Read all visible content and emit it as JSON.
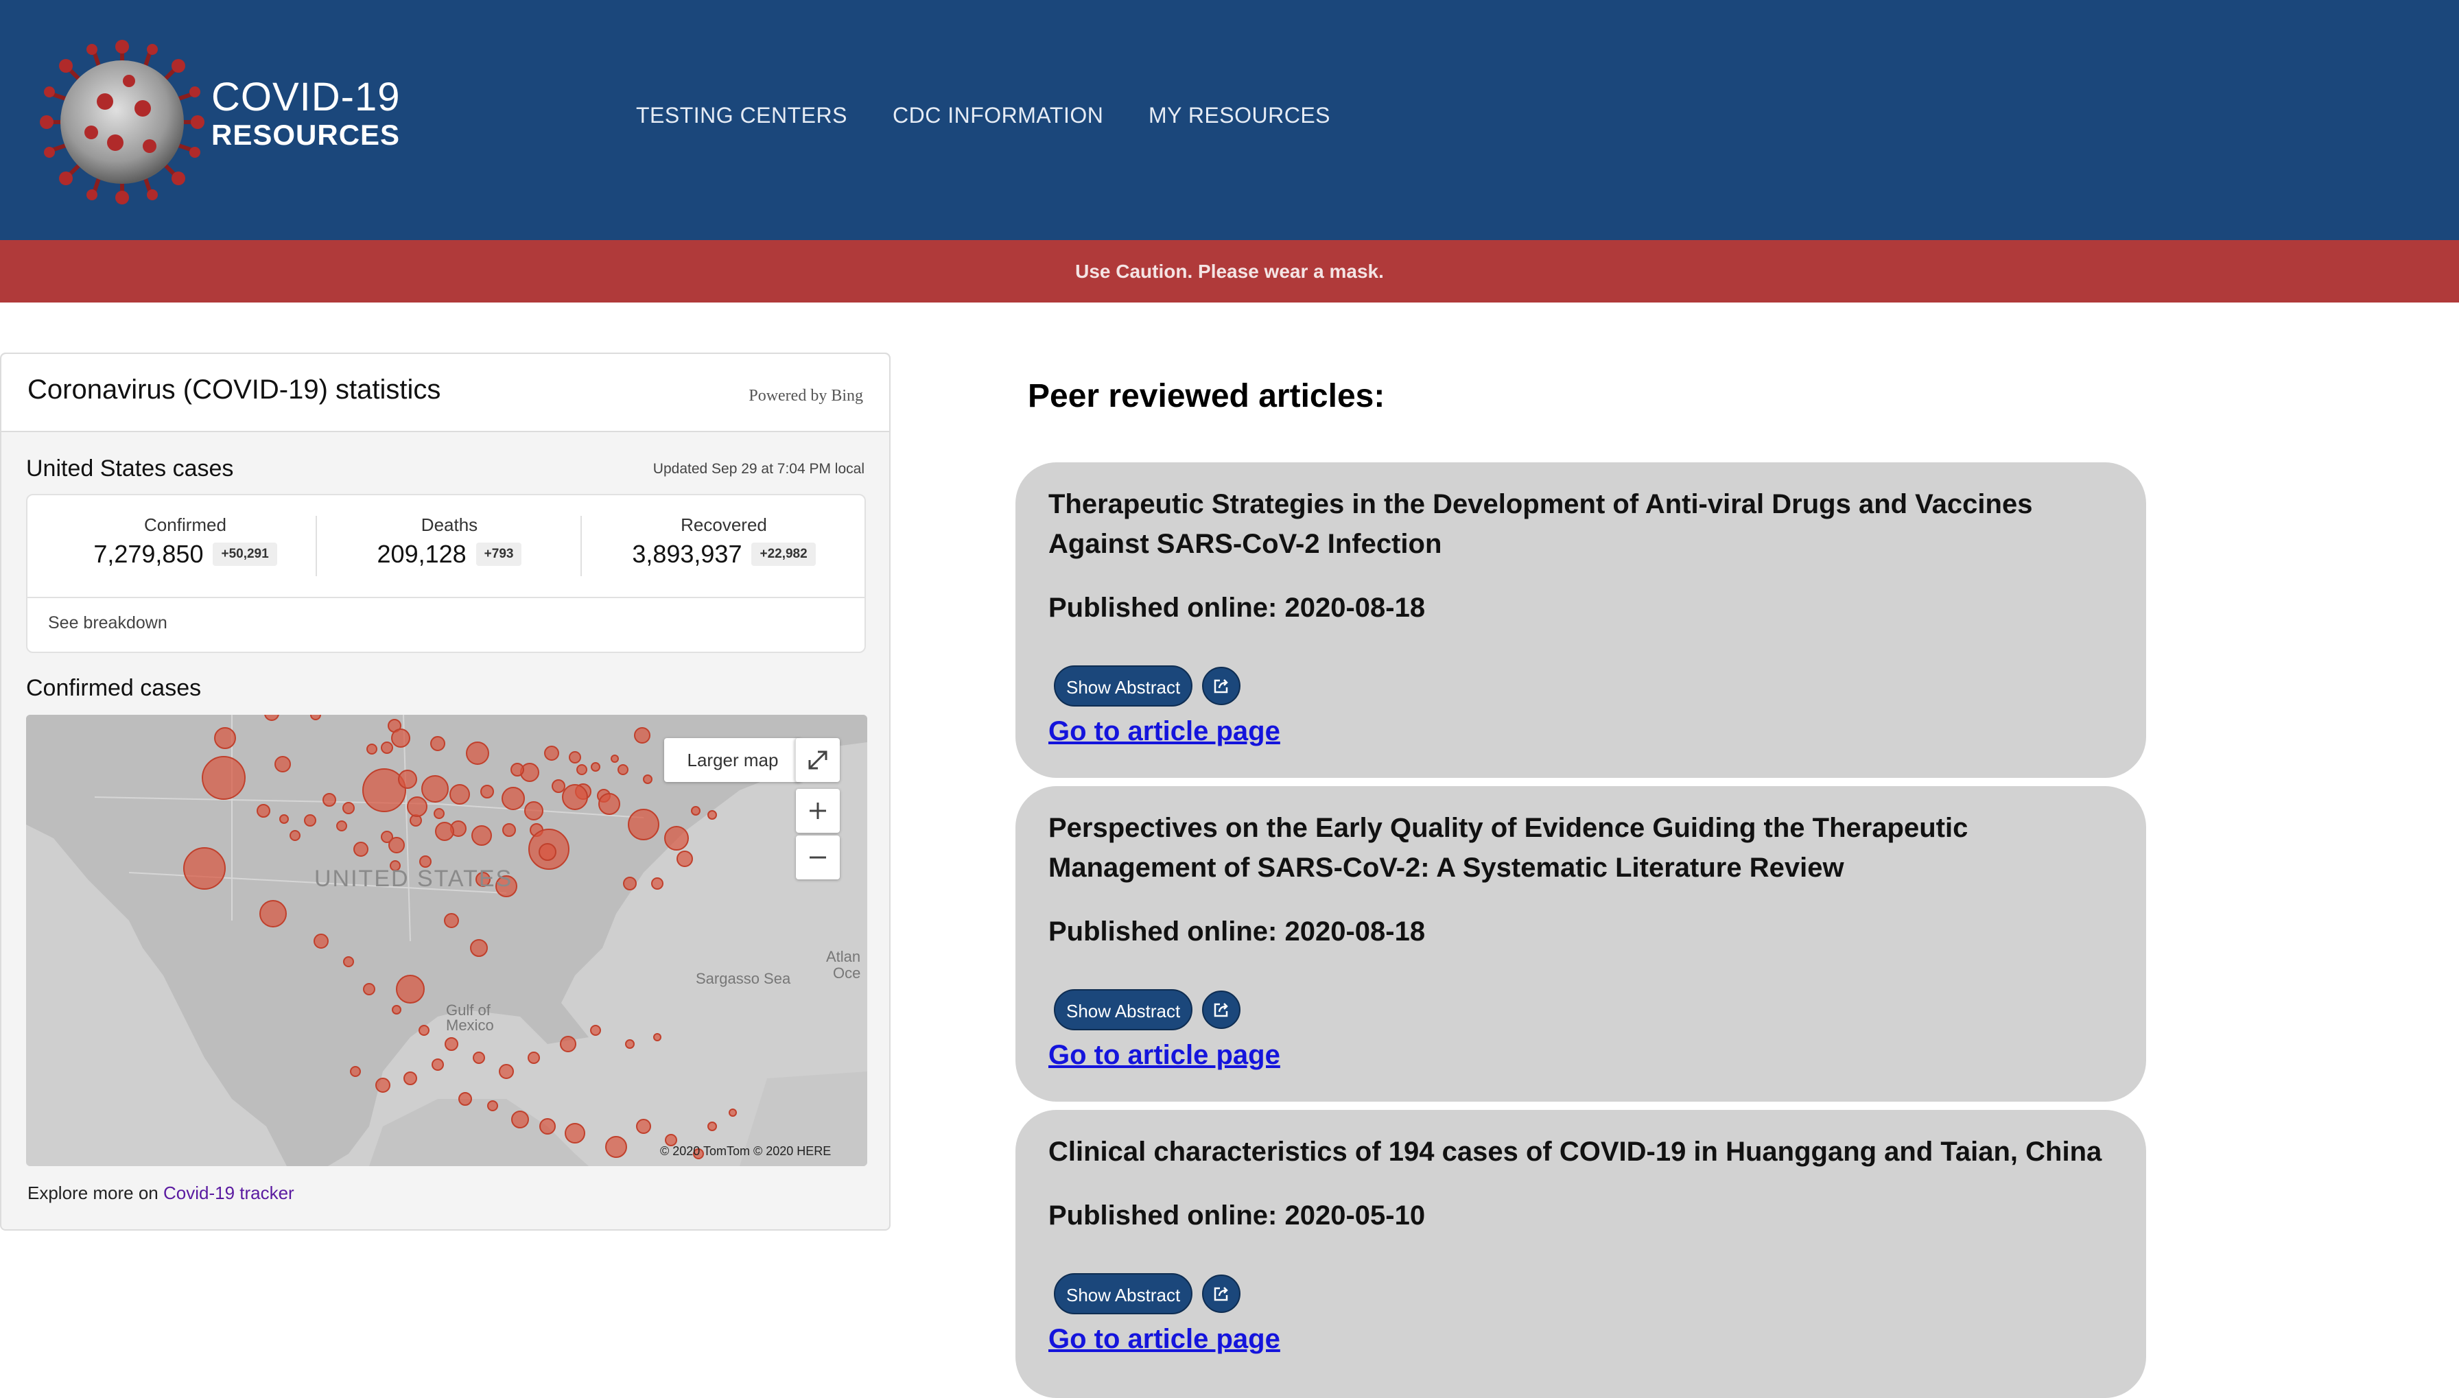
{
  "header": {
    "logo_line1": "COVID-19",
    "logo_line2": "RESOURCES",
    "nav": [
      {
        "label": "TESTING CENTERS"
      },
      {
        "label": "CDC INFORMATION"
      },
      {
        "label": "MY RESOURCES"
      }
    ]
  },
  "banner": {
    "text": "Use Caution. Please wear a mask."
  },
  "widget": {
    "title": "Coronavirus (COVID-19) statistics",
    "powered_by": "Powered by Bing",
    "region_title": "United States cases",
    "updated": "Updated Sep 29 at 7:04 PM local",
    "stats": [
      {
        "label": "Confirmed",
        "value": "7,279,850",
        "delta": "+50,291"
      },
      {
        "label": "Deaths",
        "value": "209,128",
        "delta": "+793"
      },
      {
        "label": "Recovered",
        "value": "3,893,937",
        "delta": "+22,982"
      }
    ],
    "breakdown_label": "See breakdown",
    "map_title": "Confirmed cases",
    "map": {
      "larger_map_label": "Larger map",
      "labels": {
        "country": "UNITED STATES",
        "gulf": "Gulf of",
        "mexico": "Mexico",
        "sargasso": "Sargasso Sea",
        "atlantic1": "Atlan",
        "atlantic2": "Oce"
      },
      "copyright": "© 2020 TomTom © 2020 HERE",
      "bubble_color": "#d9553f"
    },
    "explore_prefix": "Explore more on ",
    "explore_link": "Covid-19 tracker"
  },
  "articles": {
    "heading": "Peer reviewed articles:",
    "show_abstract_label": "Show Abstract",
    "go_label": "Go to article page",
    "items": [
      {
        "title": "Therapeutic Strategies in the Development of Anti-viral Drugs and Vaccines Against SARS-CoV-2 Infection",
        "published": "Published online: 2020-08-18"
      },
      {
        "title": "Perspectives on the Early Quality of Evidence Guiding the Therapeutic Management of SARS-CoV-2: A Systematic Literature Review",
        "published": "Published online: 2020-08-18"
      },
      {
        "title": "Clinical characteristics of 194 cases of COVID-19 in Huanggang and Taian, China",
        "published": "Published online: 2020-05-10"
      }
    ]
  },
  "colors": {
    "header_bg": "#1b477b",
    "banner_bg": "#b03a3a",
    "card_bg": "#d2d2d2",
    "link": "#1414dc"
  }
}
